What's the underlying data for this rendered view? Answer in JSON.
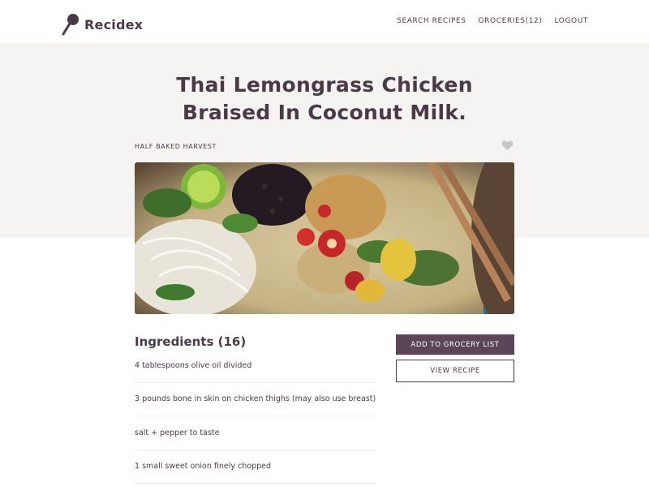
{
  "brand": {
    "name": "Recidex",
    "icon": "spoon-icon"
  },
  "nav": {
    "search": "SEARCH RECIPES",
    "groceries": "GROCERIES(12)",
    "logout": "LOGOUT"
  },
  "recipe": {
    "title_line1": "Thai Lemongrass Chicken",
    "title_line2": "Braised In Coconut Milk.",
    "source": "HALF BAKED HARVEST",
    "favorite_icon": "heart-icon"
  },
  "ingredients": {
    "heading": "Ingredients (16)",
    "items": [
      "4 tablespoons olive oil divided",
      "3 pounds bone in skin on chicken thighs (may also use breast)",
      "salt + pepper to taste",
      "1 small sweet onion finely chopped"
    ]
  },
  "actions": {
    "add_to_grocery": "ADD TO GROCERY LIST",
    "view_recipe": "VIEW RECIPE"
  },
  "colors": {
    "brand": "#4a3a48",
    "primary_button": "#5a4656",
    "band": "#f5f4f2"
  }
}
